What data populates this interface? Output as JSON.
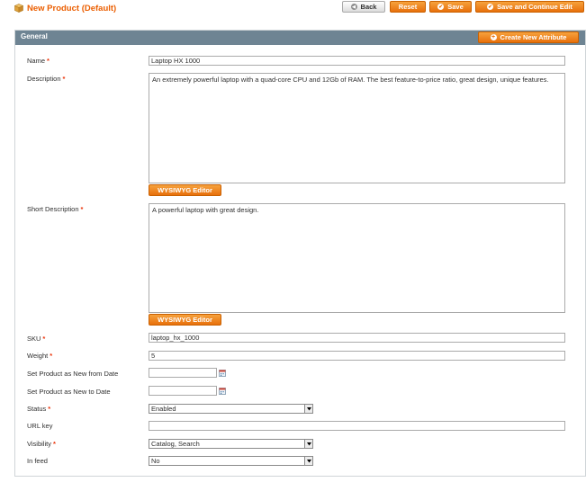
{
  "page": {
    "title": "New Product (Default)"
  },
  "toolbar": {
    "back_label": "Back",
    "reset_label": "Reset",
    "save_label": "Save",
    "save_continue_label": "Save and Continue Edit"
  },
  "panel": {
    "title": "General",
    "create_attribute_label": "Create New Attribute"
  },
  "required_mark": "*",
  "fields": {
    "name": {
      "label": "Name",
      "value": "Laptop HX 1000"
    },
    "description": {
      "label": "Description",
      "value": "An extremely powerful laptop with a quad-core CPU and 12Gb of RAM. The best feature-to-price ratio, great design, unique features."
    },
    "wysiwyg_label": "WYSIWYG Editor",
    "short_description": {
      "label": "Short Description",
      "value": "A powerful laptop with great design."
    },
    "sku": {
      "label": "SKU",
      "value": "laptop_hx_1000"
    },
    "weight": {
      "label": "Weight",
      "value": "5"
    },
    "new_from": {
      "label": "Set Product as New from Date",
      "value": ""
    },
    "new_to": {
      "label": "Set Product as New to Date",
      "value": ""
    },
    "status": {
      "label": "Status",
      "value": "Enabled"
    },
    "url_key": {
      "label": "URL key",
      "value": ""
    },
    "visibility": {
      "label": "Visibility",
      "value": "Catalog, Search"
    },
    "in_feed": {
      "label": "In feed",
      "value": "No"
    }
  },
  "colors": {
    "accent": "#eb5e00",
    "button_orange": "#e8700c",
    "panel_header": "#6e8493",
    "required": "#eb340a"
  },
  "icons": {
    "title": "product-box-icon",
    "back": "arrow-left-icon",
    "save": "checkmark-icon",
    "create": "plus-icon",
    "calendar": "calendar-icon",
    "dropdown": "chevron-down-icon"
  }
}
